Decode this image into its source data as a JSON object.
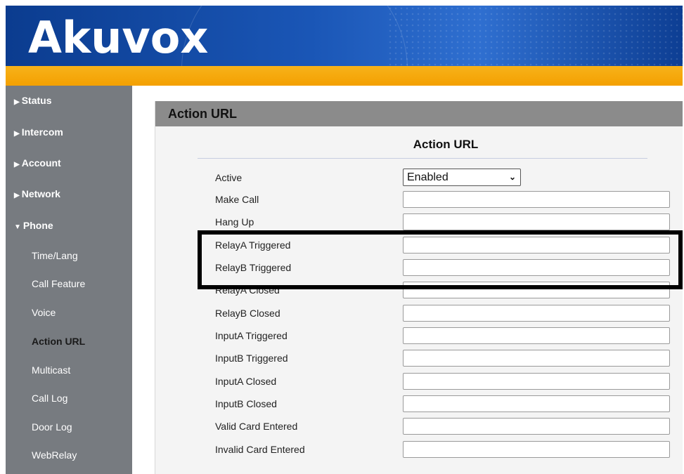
{
  "brand": {
    "logo_text": "Akuvox"
  },
  "sidebar": {
    "items": [
      {
        "label": "Status",
        "expanded": false
      },
      {
        "label": "Intercom",
        "expanded": false
      },
      {
        "label": "Account",
        "expanded": false
      },
      {
        "label": "Network",
        "expanded": false
      },
      {
        "label": "Phone",
        "expanded": true
      }
    ],
    "phone_sub_items": [
      {
        "label": "Time/Lang"
      },
      {
        "label": "Call Feature"
      },
      {
        "label": "Voice"
      },
      {
        "label": "Action URL",
        "active": true
      },
      {
        "label": "Multicast"
      },
      {
        "label": "Call Log"
      },
      {
        "label": "Door Log"
      },
      {
        "label": "WebRelay"
      }
    ]
  },
  "panel": {
    "title": "Action URL",
    "section_title": "Action URL",
    "active_label": "Active",
    "active_value": "Enabled",
    "fields": [
      {
        "label": "Make Call",
        "value": ""
      },
      {
        "label": "Hang Up",
        "value": ""
      },
      {
        "label": "RelayA Triggered",
        "value": ""
      },
      {
        "label": "RelayB Triggered",
        "value": ""
      },
      {
        "label": "RelayA Closed",
        "value": ""
      },
      {
        "label": "RelayB Closed",
        "value": ""
      },
      {
        "label": "InputA Triggered",
        "value": ""
      },
      {
        "label": "InputB Triggered",
        "value": ""
      },
      {
        "label": "InputA Closed",
        "value": ""
      },
      {
        "label": "InputB Closed",
        "value": ""
      },
      {
        "label": "Valid Card Entered",
        "value": ""
      },
      {
        "label": "Invalid Card Entered",
        "value": ""
      }
    ]
  },
  "colors": {
    "header_blue": "#1a56b6",
    "accent_orange": "#f4a000",
    "sidebar_gray": "#777b80",
    "highlight": "#000000"
  }
}
